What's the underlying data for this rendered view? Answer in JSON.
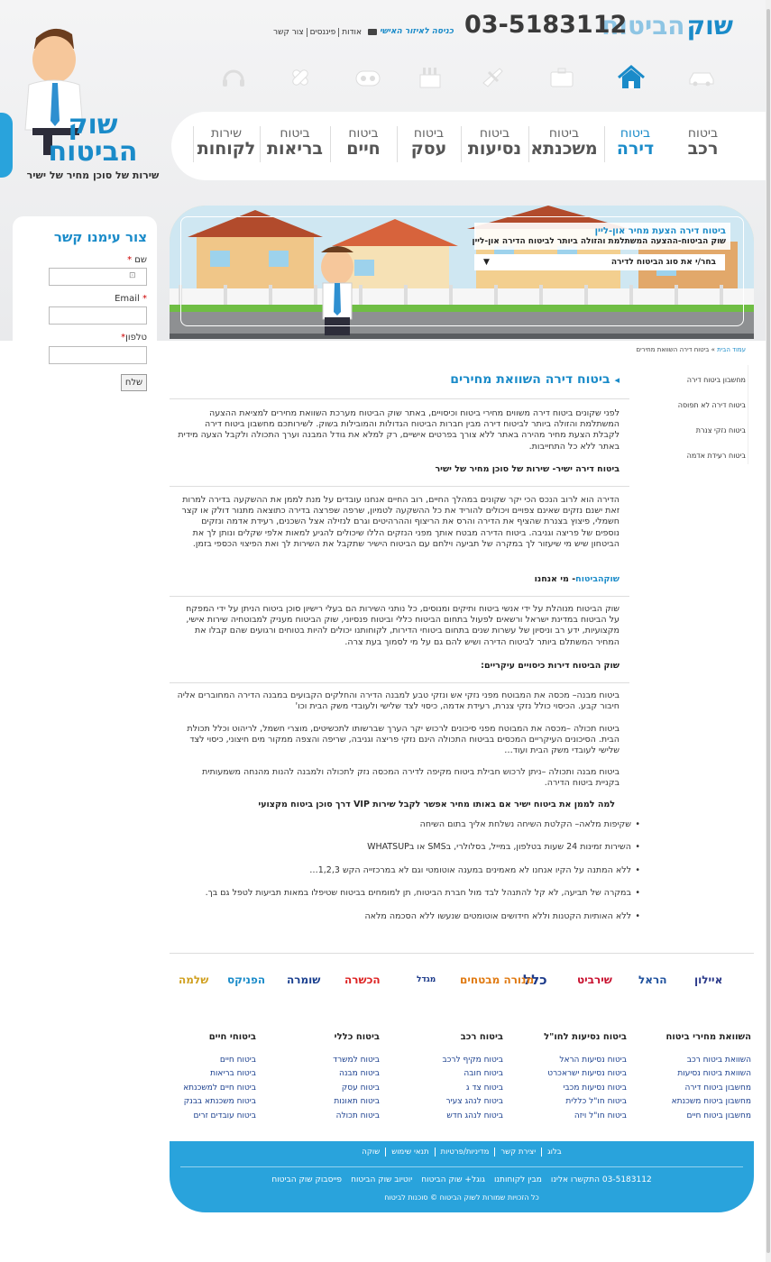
{
  "header": {
    "brand_part1": "שוק",
    "brand_part2": "הביטוח",
    "phone": "03-5183112",
    "login_link": "כניסה לאיזור האישי",
    "top_nav": [
      "אודות",
      "פיננסים",
      "צור קשר"
    ]
  },
  "category_icons": [
    "car-icon",
    "home-icon",
    "briefcase-icon",
    "plane-icon",
    "factory-icon",
    "stethoscope-icon",
    "bandage-icon",
    "headset-icon"
  ],
  "tabs": [
    {
      "line1": "ביטוח",
      "line2": "רכב",
      "active": false
    },
    {
      "line1": "ביטוח",
      "line2": "דירה",
      "active": true
    },
    {
      "line1": "ביטוח",
      "line2": "משכנתא",
      "active": false
    },
    {
      "line1": "ביטוח",
      "line2": "נסיעות",
      "active": false
    },
    {
      "line1": "ביטוח",
      "line2": "עסק",
      "active": false
    },
    {
      "line1": "ביטוח",
      "line2": "חיים",
      "active": false
    },
    {
      "line1": "ביטוח",
      "line2": "בריאות",
      "active": false
    },
    {
      "line1": "שירות",
      "line2": "לקוחות",
      "active": false
    }
  ],
  "logo": {
    "line1": "שוק",
    "line2": "הביטוח",
    "tagline": "שירות של סוכן מחיר של ישיר"
  },
  "contact": {
    "title": "צור עימנו קשר",
    "name_label": "שם",
    "email_label": "Email",
    "phone_label": "טלפון",
    "required_mark": "*",
    "send_label": "שלח"
  },
  "hero": {
    "title": "ביטוח דירה הצעת מחיר און-ליין",
    "subtitle": "שוק הביטוח-ההצעה המשתלמת והזולה ביותר לביטוח הדירה און-ליין",
    "select_placeholder": "בחר/י את סוג הביטוח לדירה",
    "select_arrow": "▼"
  },
  "breadcrumb": {
    "home": "עמוד הבית",
    "separator": "»",
    "current": "ביטוח דירה השוואת מחירים"
  },
  "side_menu": [
    "מחשבון ביטוח דירה",
    "ביטוח דירה לא תפוסה",
    "ביטוח נזקי צנרת",
    "ביטוח רעידת אדמה"
  ],
  "main": {
    "arrow": "◂",
    "title": "ביטוח דירה השוואת מחירים",
    "intro": "לפני שקונים ביטוח דירה משווים מחירי ביטוח וכיסויים, באתר שוק הביטוח מערכת השוואת מחירים למציאת ההצעה המשתלמת והזולה ביותר לביטוח דירה מבין חברות הביטוח הגדולות והמובילות בשוק. לשירותכם מחשבון ביטוח דירה לקבלת הצעת מחיר מהירה באתר ללא צורך בפרטים אישיים, רק למלא את גודל המבנה וערך התכולה ולקבל הצעה מידית באתר ללא כל התחייבות.",
    "h1": "ביטוח דירה ישיר- שירות של סוכן מחיר של ישיר",
    "p1": "הדירה הוא לרוב הנכס הכי יקר שקונים במהלך החיים, רוב החיים אנחנו עובדים על מנת לממן את ההשקעה בדירה למרות זאת ישנם נזקים שאינם צפויים ויכולים להוריד את כל ההשקעה לטמיון, שרפה שפרצה בדירה כתוצאה מתנור דולק או קצר חשמלי, פיצוץ בצנרת שהציף את הדירה והרס את הריצוף וההרהיטים וגרם לנזילה אצל השכנים, רעידת אדמה ונזקים נוספים של פריצה וגניבה. ביטוח הדירה מבטח אותך מפני הנזקים הללו שיכולים להגיע למאות אלפי שקלים ונותן לך את הביטחון שיש מי שיעזור לך במקרה של תביעה וילחם עם הביטוח הישיר שתקבל את השירות לך ואת הפיצוי הכספי בזמן.",
    "h2_part1": "שוק",
    "h2_part2": "הביטוח",
    "h2_part3": "- מי אנחנו",
    "p2": "שוק הביטוח מנוהלת על ידי אנשי ביטוח ותיקים ומנוסים, כל נותני השירות הם בעלי רישיון סוכן ביטוח הניתן על ידי המפקח על הביטוח במדינת ישראל ורשאים לפעול בתחום הביטוח כללי וביטוח פנסיוני, שוק הביטוח מעניק למבוטחיה שירות אישי, מקצועיות, ידע רב וניסיון של עשרות שנים בתחום ביטוחי הדירות, לקוחותנו יכולים להיות בטוחים ורגועים שהם קבלו את המחיר המשתלם ביותר לביטוח הדירה ושיש להם גם על מי לסמוך בעת צרה.",
    "h3": "שוק הביטוח דירות כיסויים עיקריים:",
    "p3": "ביטוח מבנה– מכסה את המבוטח מפני נזקי אש ונזקי טבע למבנה הדירה והחלקים הקבועים במבנה הדירה המחוברים אליה חיבור קבע. הכיסוי כולל נזקי צנרת, רעידת אדמה, כיסוי לצד שלישי ולעובדי משק הבית וכו'",
    "p4": "ביטוח תכולה –מכסה את המבוטח מפני סיכונים לרכוש יקר הערך שברשותו לתכשיטים, מוצרי חשמל, לריהוט וכלל תכולת הבית. הסיכונים העיקריים המכסים בביטוח התכולה הינם נזקי פריצה וגניבה, שריפה והצפה ממקור מים חיצוני, כיסוי לצד שלישי לעובדי משק הבית ועוד…",
    "p5": "ביטוח מבנה ותכולה –ניתן לרכוש חבילת ביטוח מקיפה לדירה המכסה נזק לתכולה ולמבנה להנות מהנחה משמעותית בקניית ביטוח הדירה.",
    "h4": "למה לממן את ביטוח ישיר אם באותו מחיר אפשר לקבל שירות VIP דרך סוכן ביטוח מקצועי",
    "bullets": [
      "שקיפות מלאה– הקלטת השיחה נשלחת אליך בתום השיחה",
      "השירות זמינות 24 שעות בטלפון, במייל, בסלולרי, בSMS או בWHATSUP",
      "ללא המתנה על הקיו אנחנו לא מאמינים במענה אוטומטי וגם לא במרכזייה הקש 1,2,3…",
      "במקרה של תביעה, לא קל להתנהל לבד מול חברת הביטוח, תן למומחים בביטוח שטיפלו במאות תביעות לטפל גם בך.",
      "ללא האותיות הקטנות וללא חידושים אוטומטים שנעשו ללא הסכמה מלאה"
    ]
  },
  "insurers": [
    "איילון",
    "הראל",
    "שירביט",
    "כלל",
    "מנורה מבטחים",
    "מגדל",
    "הכשרה",
    "שומרה",
    "הפניקס",
    "שלמה"
  ],
  "footer_columns": [
    {
      "title": "השוואת מחירי ביטוח",
      "links": [
        "השוואת ביטוח רכב",
        "השוואת ביטוח נסיעות",
        "מחשבון ביטוח דירה",
        "מחשבון ביטוח משכנתא",
        "מחשבון ביטוח חיים"
      ]
    },
    {
      "title": "ביטוח נסיעות לחו\"ל",
      "links": [
        "ביטוח נסיעות הראל",
        "ביטוח נסיעות ישראכרט",
        "ביטוח נסיעות מכבי",
        "ביטוח חו\"ל כללית",
        "ביטוח חו\"ל ויזה"
      ]
    },
    {
      "title": "ביטוח רכב",
      "links": [
        "ביטוח מקיף לרכב",
        "ביטוח חובה",
        "ביטוח צד ג",
        "ביטוח לנהג צעיר",
        "ביטוח לנהג חדש"
      ]
    },
    {
      "title": "ביטוח כללי",
      "links": [
        "ביטוח למשרד",
        "ביטוח מבנה",
        "ביטוח עסק",
        "ביטוח תאונות",
        "ביטוח תכולה"
      ]
    },
    {
      "title": "ביטוחי חיים",
      "links": [
        "ביטוח חיים",
        "ביטוח בריאות",
        "ביטוח חיים למשכנתא",
        "ביטוח משכנתא בבנק",
        "ביטוח עובדים זרים"
      ]
    }
  ],
  "footer": {
    "links_row1": [
      "בלוג",
      "יצירת קשר",
      "מדיניות/פרטיות",
      "תנאי שימוש",
      "שוקה"
    ],
    "links_row2": [
      "03-5183112 התקשרו אלינו",
      "מבין לקוחותנו",
      "גוגל+ שוק הביטוח",
      "יוטיוב שוק הביטוח",
      "פייסבוק שוק הביטוח"
    ],
    "copyright": "כל הזכויות שמורות לשוק הביטוח © סוכנות לביטוח"
  },
  "colors": {
    "accent": "#1a8bc9",
    "footer_bg": "#29a3dc"
  }
}
